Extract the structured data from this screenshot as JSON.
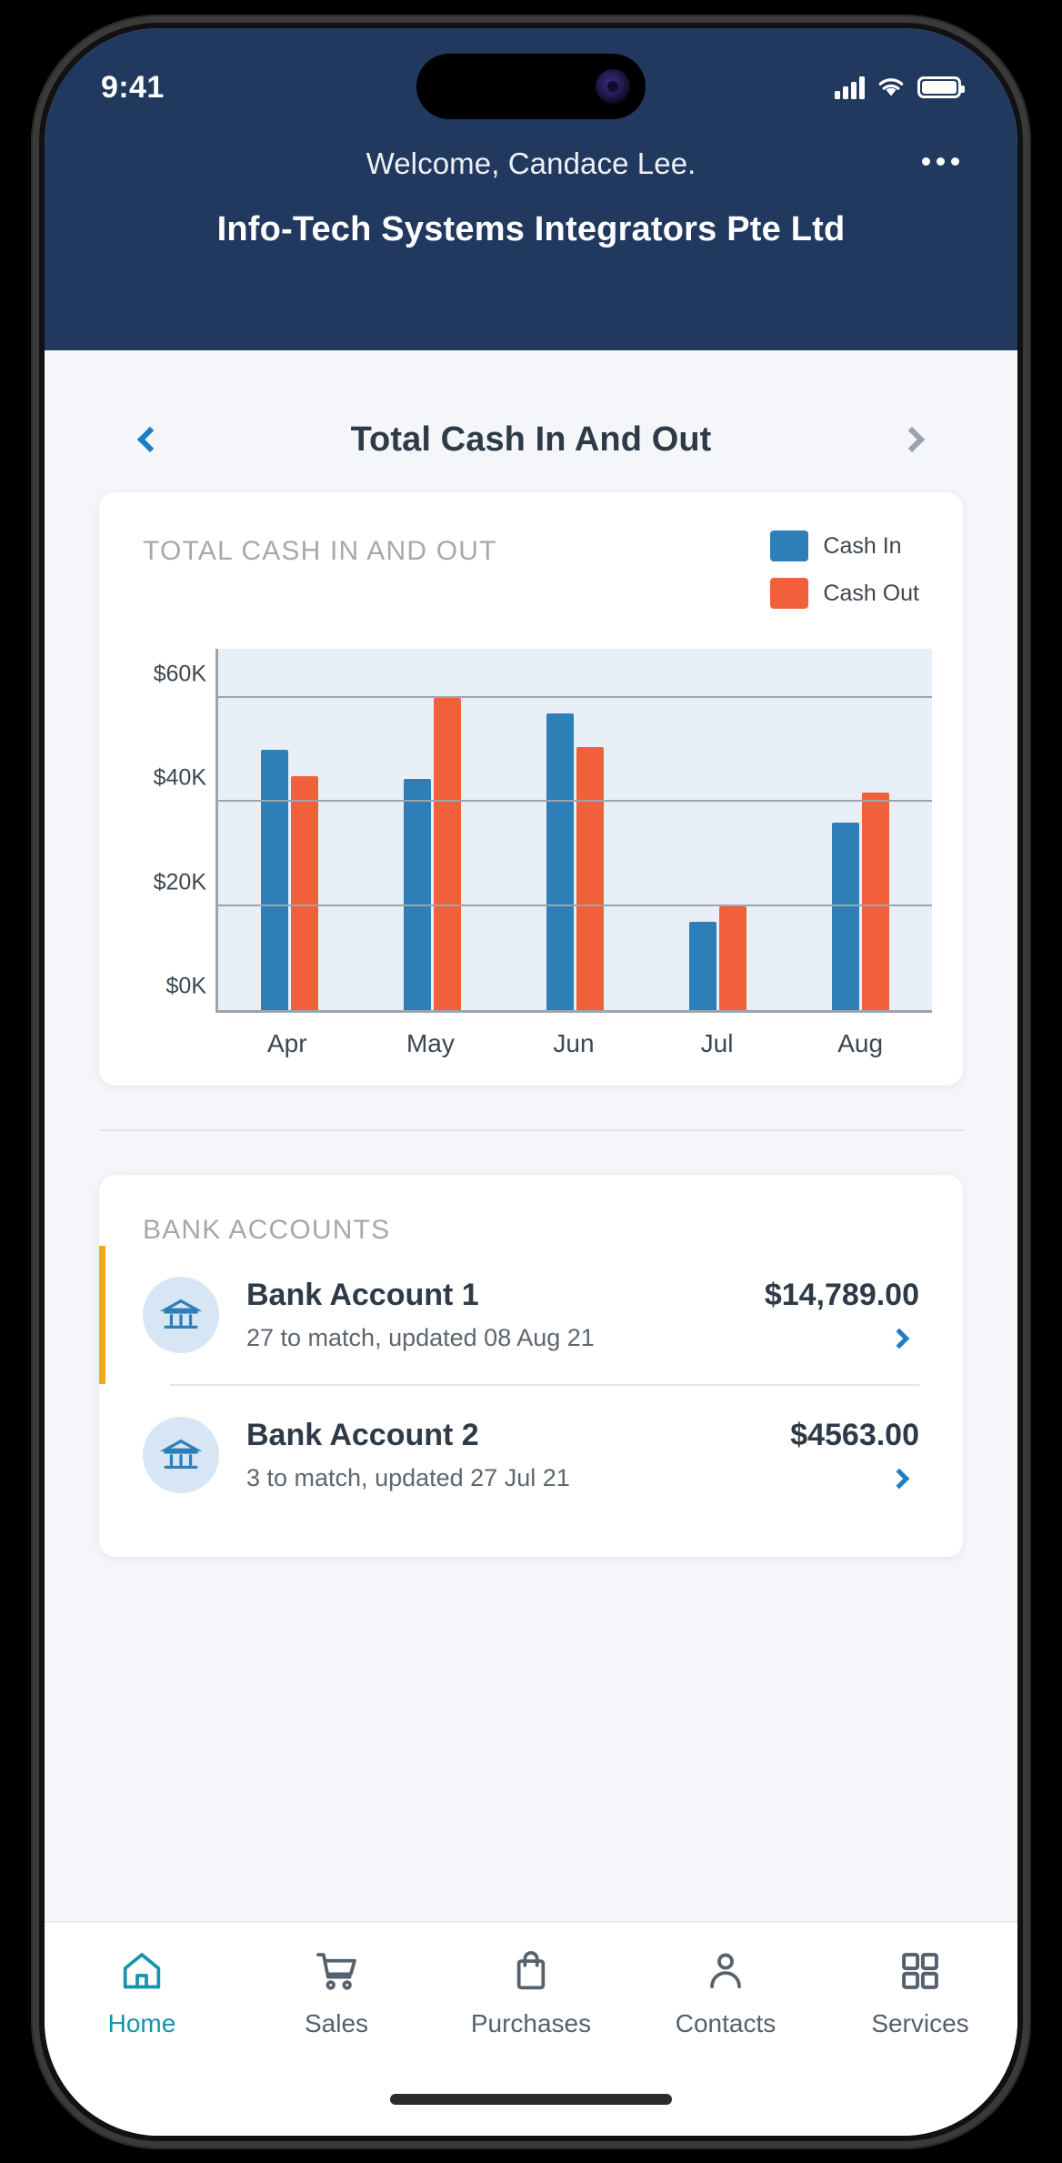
{
  "status_bar": {
    "time": "9:41",
    "icons": [
      "signal-icon",
      "wifi-icon",
      "battery-icon"
    ]
  },
  "header": {
    "welcome_text": "Welcome, Candace Lee.",
    "company_name": "Info-Tech Systems Integrators Pte Ltd",
    "more_menu_label": "more-options"
  },
  "carousel": {
    "title": "Total Cash In And Out",
    "prev_label": "previous-widget",
    "next_label": "next-widget"
  },
  "chart_card": {
    "title": "TOTAL CASH IN AND OUT"
  },
  "chart_data": {
    "type": "bar",
    "title": "TOTAL CASH IN AND OUT",
    "xlabel": "",
    "ylabel": "",
    "categories": [
      "Apr",
      "May",
      "Jun",
      "Jul",
      "Aug"
    ],
    "series": [
      {
        "name": "Cash In",
        "color": "#2e7fb8",
        "values": [
          50000,
          44500,
          57000,
          17000,
          36000
        ]
      },
      {
        "name": "Cash Out",
        "color": "#f1603a",
        "values": [
          45000,
          60000,
          50500,
          20000,
          41800
        ]
      }
    ],
    "ylim": [
      0,
      70000
    ],
    "yticks": [
      0,
      20000,
      40000,
      60000
    ],
    "ytick_labels": [
      "$0K",
      "$20K",
      "$40K",
      "$60K"
    ],
    "grid": true,
    "legend_position": "top-right",
    "plot_background": "#e9eff6"
  },
  "bank_section": {
    "title": "BANK ACCOUNTS",
    "accounts": [
      {
        "name": "Bank Account 1",
        "amount": "$14,789.00",
        "subtitle": "27 to match, updated 08 Aug 21",
        "accent": "#f2a81d",
        "has_accent": true
      },
      {
        "name": "Bank Account 2",
        "amount": "$4563.00",
        "subtitle": "3 to match, updated 27 Jul 21",
        "accent": "#f2a81d",
        "has_accent": false
      }
    ]
  },
  "bottom_nav": {
    "items": [
      {
        "label": "Home",
        "icon": "home-icon",
        "active": true
      },
      {
        "label": "Sales",
        "icon": "cart-icon",
        "active": false
      },
      {
        "label": "Purchases",
        "icon": "bag-icon",
        "active": false
      },
      {
        "label": "Contacts",
        "icon": "person-icon",
        "active": false
      },
      {
        "label": "Services",
        "icon": "grid-icon",
        "active": false
      }
    ],
    "active_color": "#1694ad",
    "inactive_color": "#55616c"
  },
  "colors": {
    "header_bg": "#21395e",
    "page_bg": "#f4f6f9",
    "accent_blue": "#1f7dc4",
    "cash_in": "#2e7fb8",
    "cash_out": "#f1603a"
  }
}
